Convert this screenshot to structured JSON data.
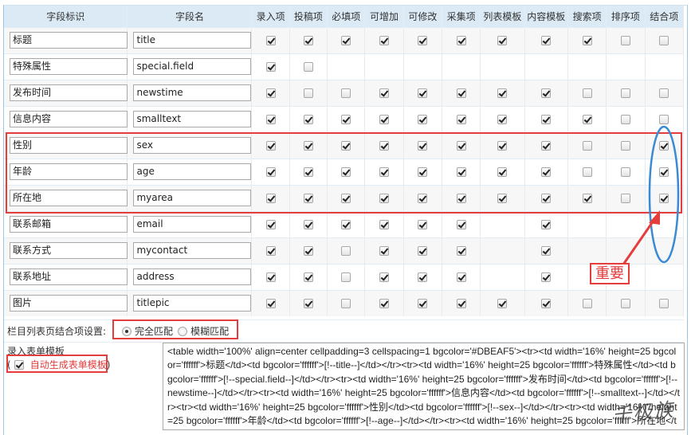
{
  "table": {
    "headers": [
      "字段标识",
      "字段名",
      "录入项",
      "投稿项",
      "必填项",
      "可增加",
      "可修改",
      "采集项",
      "列表模板",
      "内容模板",
      "搜索项",
      "排序项",
      "结合项"
    ],
    "rows": [
      {
        "label": "标题",
        "name": "title",
        "flags": [
          1,
          1,
          1,
          1,
          1,
          1,
          1,
          1,
          1,
          0,
          0
        ]
      },
      {
        "label": "特殊属性",
        "name": "special.field",
        "flags": [
          1,
          0,
          null,
          null,
          null,
          null,
          null,
          null,
          null,
          null,
          null
        ]
      },
      {
        "label": "发布时间",
        "name": "newstime",
        "flags": [
          1,
          0,
          0,
          1,
          1,
          1,
          1,
          1,
          0,
          0,
          0
        ]
      },
      {
        "label": "信息内容",
        "name": "smalltext",
        "flags": [
          1,
          1,
          1,
          1,
          1,
          1,
          1,
          1,
          1,
          0,
          0
        ]
      },
      {
        "label": "性别",
        "name": "sex",
        "flags": [
          1,
          1,
          1,
          1,
          1,
          1,
          1,
          1,
          0,
          0,
          1
        ]
      },
      {
        "label": "年龄",
        "name": "age",
        "flags": [
          1,
          1,
          1,
          1,
          1,
          1,
          1,
          1,
          0,
          0,
          1
        ]
      },
      {
        "label": "所在地",
        "name": "myarea",
        "flags": [
          1,
          1,
          1,
          1,
          1,
          1,
          1,
          1,
          1,
          0,
          1
        ]
      },
      {
        "label": "联系邮箱",
        "name": "email",
        "flags": [
          1,
          1,
          1,
          1,
          1,
          1,
          null,
          1,
          null,
          null,
          null
        ]
      },
      {
        "label": "联系方式",
        "name": "mycontact",
        "flags": [
          1,
          1,
          0,
          1,
          1,
          1,
          null,
          1,
          null,
          null,
          null
        ]
      },
      {
        "label": "联系地址",
        "name": "address",
        "flags": [
          1,
          1,
          0,
          1,
          1,
          1,
          null,
          1,
          null,
          null,
          null
        ]
      },
      {
        "label": "图片",
        "name": "titlepic",
        "flags": [
          1,
          1,
          0,
          1,
          1,
          1,
          1,
          1,
          0,
          0,
          0
        ]
      }
    ]
  },
  "combine_setting": {
    "label": "栏目列表页结合项设置:",
    "options": [
      {
        "label": "完全匹配",
        "selected": true
      },
      {
        "label": "模糊匹配",
        "selected": false
      }
    ]
  },
  "form_template": {
    "title": "录入表单模板",
    "paren_open": "(",
    "auto_label": "自动生成表单模板",
    "auto_checked": true,
    "paren_close": ")",
    "code": "<table width='100%' align=center cellpadding=3 cellspacing=1 bgcolor='#DBEAF5'><tr><td width='16%' height=25 bgcolor='ffffff'>标题</td><td bgcolor='ffffff'>[!--title--]</td></tr><tr><td width='16%' height=25 bgcolor='ffffff'>特殊属性</td><td bgcolor='ffffff'>[!--special.field--]</td></tr><tr><td width='16%' height=25 bgcolor='ffffff'>发布时间</td><td bgcolor='ffffff'>[!--newstime--]</td></tr><tr><td width='16%' height=25 bgcolor='ffffff'>信息内容</td><td bgcolor='ffffff'>[!--smalltext--]</td></tr><tr><td width='16%' height=25 bgcolor='ffffff'>性别</td><td bgcolor='ffffff'>[!--sex--]</td></tr><tr><td width='16%' height=25 bgcolor='ffffff'>年龄</td><td bgcolor='ffffff'>[!--age--]</td></tr><tr><td width='16%' height=25 bgcolor='ffffff'>所在地</td><td bgcolor='ffffff'>[!--myarea--]</td></tr>"
  },
  "annotations": {
    "important_label": "重要",
    "watermark": "千极族"
  },
  "colors": {
    "header_bg": "#dbeaf5",
    "highlight_red": "#e53c3c",
    "highlight_blue": "#3b8bd4"
  }
}
